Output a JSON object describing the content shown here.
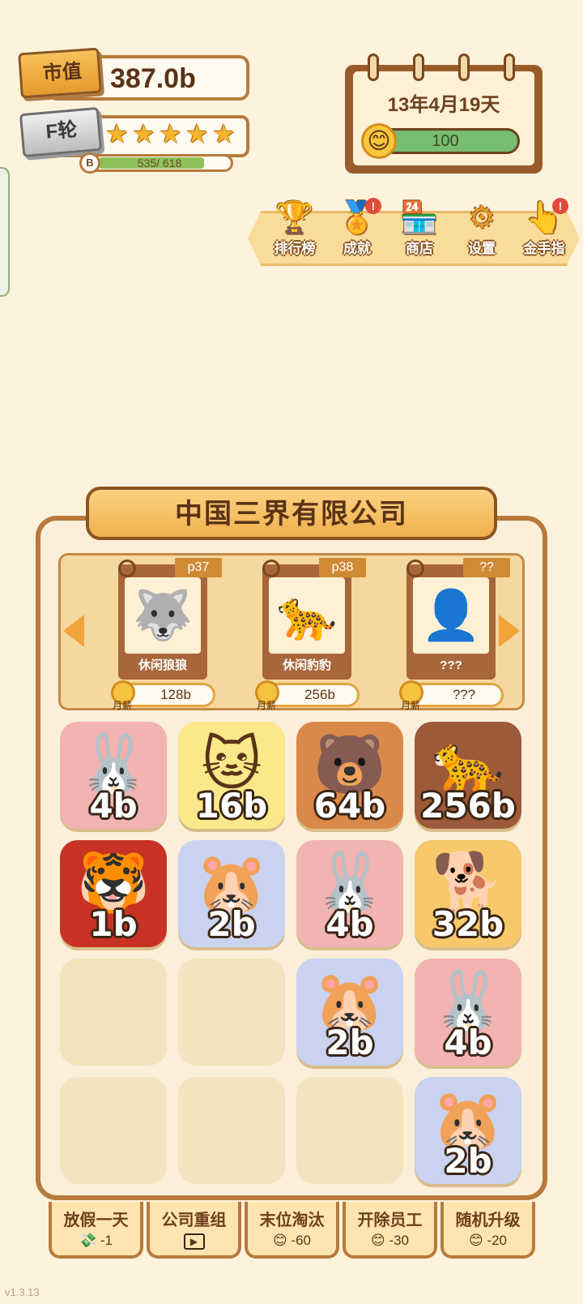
{
  "header": {
    "market_value_label": "市值",
    "market_value": "387.0b",
    "round_label": "F轮",
    "stars": [
      "★",
      "★",
      "★",
      "★",
      "★"
    ],
    "xp_badge": "B",
    "xp_text": "535/ 618",
    "xp_progress": 0.866
  },
  "calendar": {
    "date": "13年4月19天",
    "mood_icon": "😊",
    "mood_value": "100"
  },
  "menu": {
    "items": [
      {
        "label": "排行榜",
        "icon": "🏆",
        "badge": ""
      },
      {
        "label": "成就",
        "icon": "🏅",
        "badge": "!"
      },
      {
        "label": "商店",
        "icon": "🏪",
        "badge": ""
      },
      {
        "label": "设置",
        "icon": "⚙",
        "badge": ""
      },
      {
        "label": "金手指",
        "icon": "👆",
        "badge": "!"
      }
    ]
  },
  "company": {
    "name": "中国三界有限公司"
  },
  "showcase": {
    "cards": [
      {
        "tag": "p37",
        "name": "休闲狼狼",
        "icon": "🐺",
        "price": "128b",
        "price_sub": "月薪"
      },
      {
        "tag": "p38",
        "name": "休闲豹豹",
        "icon": "🐆",
        "price": "256b",
        "price_sub": "月薪"
      },
      {
        "tag": "??",
        "name": "???",
        "icon": "👤",
        "price": "???",
        "price_sub": "月薪"
      }
    ]
  },
  "grid": {
    "cells": [
      {
        "label": "4b",
        "icon": "🐰",
        "bg": "#f2b3b3"
      },
      {
        "label": "16b",
        "icon": "🐱",
        "bg": "#fbe88a"
      },
      {
        "label": "64b",
        "icon": "🐻",
        "bg": "#d9894a"
      },
      {
        "label": "256b",
        "icon": "🐆",
        "bg": "#9c5a3a"
      },
      {
        "label": "1b",
        "icon": "🐯",
        "bg": "#c83224"
      },
      {
        "label": "2b",
        "icon": "🐹",
        "bg": "#c9d3f0"
      },
      {
        "label": "4b",
        "icon": "🐰",
        "bg": "#f2b3b3"
      },
      {
        "label": "32b",
        "icon": "🐕",
        "bg": "#f7c96a"
      },
      {
        "label": "",
        "icon": "",
        "bg": ""
      },
      {
        "label": "",
        "icon": "",
        "bg": ""
      },
      {
        "label": "2b",
        "icon": "🐹",
        "bg": "#c9d3f0"
      },
      {
        "label": "4b",
        "icon": "🐰",
        "bg": "#f2b3b3"
      },
      {
        "label": "",
        "icon": "",
        "bg": ""
      },
      {
        "label": "",
        "icon": "",
        "bg": ""
      },
      {
        "label": "",
        "icon": "",
        "bg": ""
      },
      {
        "label": "2b",
        "icon": "🐹",
        "bg": "#c9d3f0"
      }
    ]
  },
  "actions": [
    {
      "label": "放假一天",
      "icon": "💸",
      "cost": "-1"
    },
    {
      "label": "公司重组",
      "icon": "▶",
      "cost": ""
    },
    {
      "label": "末位淘汰",
      "icon": "😊",
      "cost": "-60"
    },
    {
      "label": "开除员工",
      "icon": "😊",
      "cost": "-30"
    },
    {
      "label": "随机升级",
      "icon": "😊",
      "cost": "-20"
    }
  ],
  "version": "v1.3.13",
  "colors": {
    "background": "#fdf3dc",
    "frame": "#b87a3c",
    "accent": "#f1a43a",
    "mood_bar": "#77bd72",
    "xp_bar": "#8ec15a"
  }
}
